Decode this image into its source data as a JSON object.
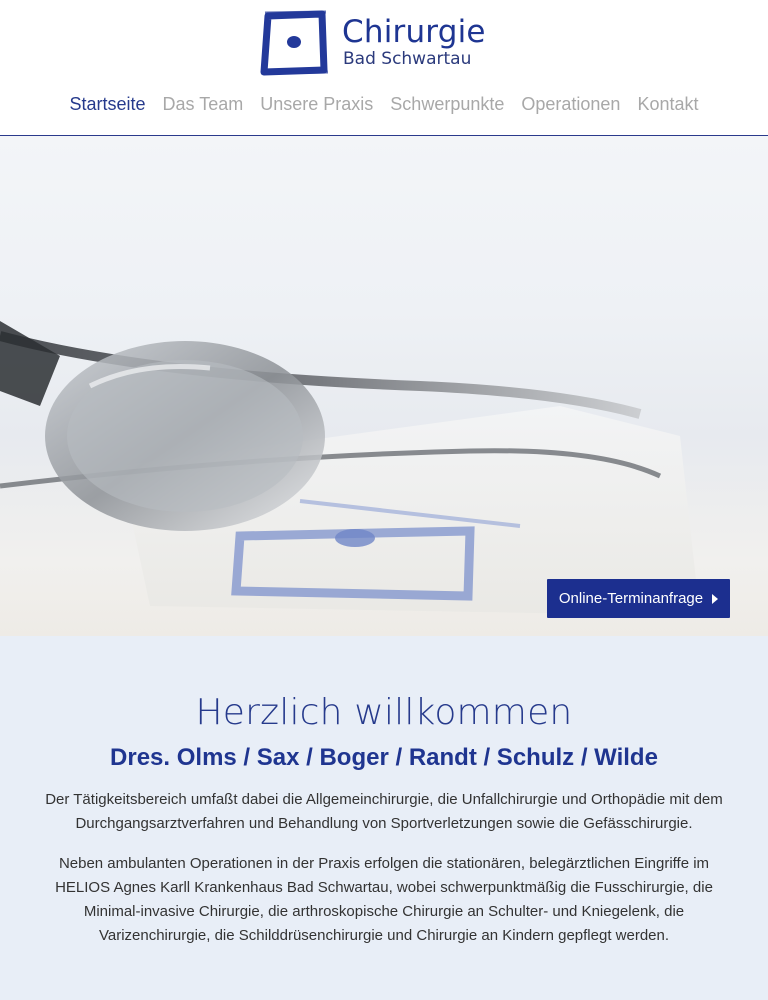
{
  "header": {
    "logo_title": "Chirurgie",
    "logo_subtitle": "Bad Schwartau",
    "logo_icon": "square-with-dot-icon"
  },
  "nav": [
    {
      "label": "Startseite",
      "active": true
    },
    {
      "label": "Das Team",
      "active": false
    },
    {
      "label": "Unsere Praxis",
      "active": false
    },
    {
      "label": "Schwerpunkte",
      "active": false
    },
    {
      "label": "Operationen",
      "active": false
    },
    {
      "label": "Kontakt",
      "active": false
    }
  ],
  "hero": {
    "image": "stethoscope-photo",
    "cta_label": "Online-Terminanfrage"
  },
  "welcome": {
    "title": "Herzlich willkommen",
    "subtitle": "Dres. Olms / Sax / Boger / Randt / Schulz / Wilde",
    "paragraph1": "Der Tätigkeitsbereich umfaßt dabei die Allgemeinchirurgie, die Unfallchirurgie und Orthopädie mit dem Durchgangsarztverfahren und Behandlung von Sportverletzungen sowie die Gefässchirurgie.",
    "paragraph2": "Neben ambulanten Operationen in der Praxis erfolgen die stationären, belegärztlichen Eingriffe im HELIOS Agnes Karll Krankenhaus Bad Schwartau, wobei schwerpunktmäßig die Fusschirurgie, die Minimal-invasive Chirurgie, die arthroskopische Chirurgie an Schulter- und Kniegelenk, die Varizenchirurgie, die Schilddrüsenchirurgie und Chirurgie an Kindern gepflegt werden."
  },
  "colors": {
    "brand": "#1e3592",
    "nav_inactive": "#a8a8a8",
    "cta_bg": "#1c2f8f",
    "welcome_bg": "#e8eef7"
  }
}
